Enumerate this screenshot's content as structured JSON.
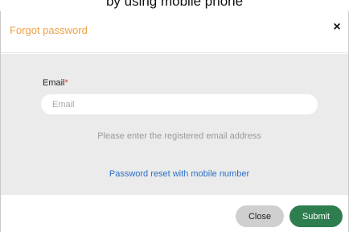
{
  "caption": {
    "text": "by using mobile phone"
  },
  "dialog": {
    "title": "Forgot password",
    "close_icon_glyph": "×"
  },
  "form": {
    "email_label": "Email",
    "required_marker": "*",
    "email_placeholder": "Email",
    "email_value": "",
    "hint": "Please enter the registered email address",
    "mobile_reset_link": "Password reset with mobile number"
  },
  "footer": {
    "close_label": "Close",
    "submit_label": "Submit"
  },
  "colors": {
    "title": "#f0a045",
    "required": "#e0352b",
    "link": "#2a6fc9",
    "submit_bg": "#2e7d4f",
    "close_bg": "#cfcfcf",
    "body_bg": "#ebebeb"
  },
  "icons": {
    "close": "close-icon"
  }
}
